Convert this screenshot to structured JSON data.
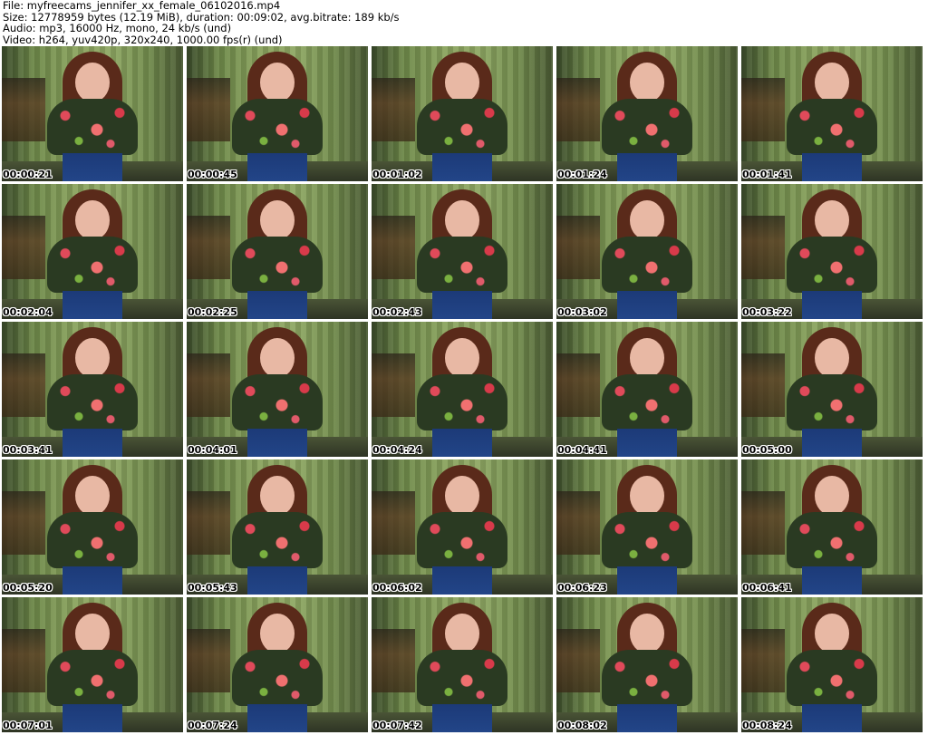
{
  "header": {
    "file": "File: myfreecams_jennifer_xx_female_06102016.mp4",
    "size": "Size: 12778959 bytes (12.19 MiB), duration: 00:09:02, avg.bitrate: 189 kb/s",
    "audio": "Audio: mp3, 16000 Hz, mono, 24 kb/s (und)",
    "video": "Video: h264, yuv420p, 320x240, 1000.00 fps(r) (und)"
  },
  "thumbnails": [
    {
      "time": "00:00:21"
    },
    {
      "time": "00:00:45"
    },
    {
      "time": "00:01:02"
    },
    {
      "time": "00:01:24"
    },
    {
      "time": "00:01:41"
    },
    {
      "time": "00:02:04"
    },
    {
      "time": "00:02:25"
    },
    {
      "time": "00:02:43"
    },
    {
      "time": "00:03:02"
    },
    {
      "time": "00:03:22"
    },
    {
      "time": "00:03:41"
    },
    {
      "time": "00:04:01"
    },
    {
      "time": "00:04:24"
    },
    {
      "time": "00:04:41"
    },
    {
      "time": "00:05:00"
    },
    {
      "time": "00:05:20"
    },
    {
      "time": "00:05:43"
    },
    {
      "time": "00:06:02"
    },
    {
      "time": "00:06:23"
    },
    {
      "time": "00:06:41"
    },
    {
      "time": "00:07:01"
    },
    {
      "time": "00:07:24"
    },
    {
      "time": "00:07:42"
    },
    {
      "time": "00:08:02"
    },
    {
      "time": "00:08:24"
    }
  ]
}
